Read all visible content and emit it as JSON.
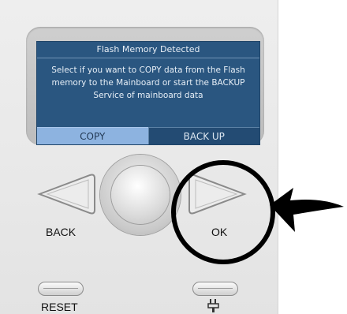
{
  "screen": {
    "title": "Flash Memory Detected",
    "message": "Select if you want to COPY data from the Flash memory to the Mainboard or start the BACKUP Service of mainboard data",
    "buttons": [
      {
        "label": "COPY",
        "selected": true
      },
      {
        "label": "BACK UP",
        "selected": false
      }
    ]
  },
  "controls": {
    "back_label": "BACK",
    "ok_label": "OK",
    "reset_label": "RESET"
  },
  "colors": {
    "screen_bg": "#2a5680",
    "selected_soft_button": "#8db3e0",
    "highlight_circle": "#000000"
  },
  "icons": {
    "callout": "arrow-pointing-left-icon",
    "bottom_right": "plug-icon"
  }
}
